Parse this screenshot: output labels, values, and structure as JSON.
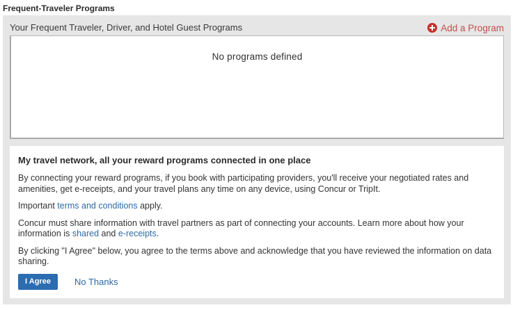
{
  "section_title": "Frequent-Traveler Programs",
  "programs": {
    "header_label": "Your Frequent Traveler, Driver, and Hotel Guest Programs",
    "add_program_label": "Add a Program",
    "empty_message": "No programs defined"
  },
  "network": {
    "title": "My travel network, all your reward programs connected in one place",
    "para1": "By connecting your reward programs, if you book with participating providers, you'll receive your negotiated rates and amenities, get e-receipts, and your travel plans any time on any device, using Concur or TripIt.",
    "para2_prefix": "Important ",
    "para2_link": "terms and conditions",
    "para2_suffix": " apply.",
    "para3_prefix": "Concur must share information with travel partners as part of connecting your accounts. Learn more about how your information is ",
    "para3_link1": "shared",
    "para3_mid": " and ",
    "para3_link2": "e-receipts",
    "para3_suffix": ".",
    "para4": "By clicking \"I Agree\" below, you agree to the terms above and acknowledge that you have reviewed the information on data sharing.",
    "agree_label": "I Agree",
    "no_thanks_label": "No Thanks"
  },
  "colors": {
    "accent": "#2c6cb0",
    "link": "#2b6aa8",
    "add_link": "#c0504d",
    "panel_bg": "#e6e6e6"
  },
  "icons": {
    "add_program": "plus-circle-icon"
  }
}
